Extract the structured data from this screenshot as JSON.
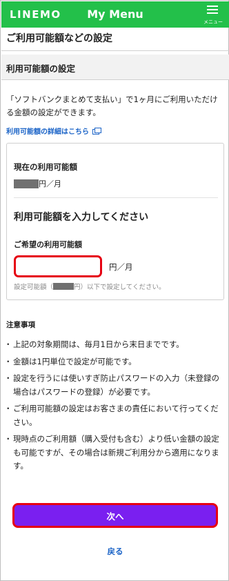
{
  "header": {
    "logo": "LINEMO",
    "title": "My Menu",
    "menu_label": "メニュー",
    "background": "#23c04a"
  },
  "page": {
    "title": "ご利用可能額などの設定",
    "section_title": "利用可能額の設定",
    "description": "「ソフトバンクまとめて支払い」で1ヶ月にご利用いただける金額の設定ができます。",
    "detail_link": "利用可能額の詳細はこちら",
    "detail_link_icon": "external-window-icon"
  },
  "card": {
    "current_label": "現在の利用可能額",
    "current_unit": "円／月",
    "enter_heading": "利用可能額を入力してください",
    "desired_label": "ご希望の利用可能額",
    "input_value": "",
    "input_unit": "円／月",
    "range_prefix": "設定可能額（",
    "range_suffix": "円）以下で設定してください。"
  },
  "notes": {
    "title": "注意事項",
    "items": [
      "上記の対象期間は、毎月1日から末日までです。",
      "金額は1円単位で設定が可能です。",
      "設定を行うには使いすぎ防止パスワードの入力（未登録の場合はパスワードの登録）が必要です。",
      "ご利用可能額の設定はお客さまの責任において行ってください。",
      "現時点のご利用額（購入受付も含む）より低い金額の設定も可能ですが、その場合は新規ご利用分から適用になります。"
    ]
  },
  "actions": {
    "next_label": "次へ",
    "back_label": "戻る",
    "button_color": "#7a1ff0",
    "highlight_color": "#e60012"
  }
}
